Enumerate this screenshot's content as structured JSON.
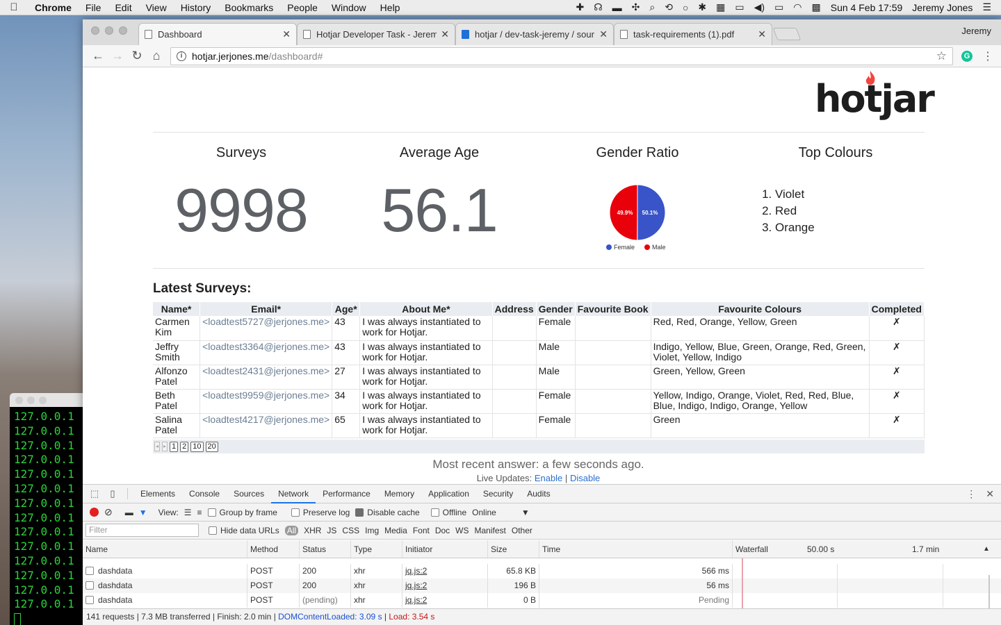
{
  "menubar": {
    "app": "Chrome",
    "items": [
      "File",
      "Edit",
      "View",
      "History",
      "Bookmarks",
      "People",
      "Window",
      "Help"
    ],
    "datetime": "Sun 4 Feb  17:59",
    "user": "Jeremy Jones"
  },
  "terminal": {
    "lines": [
      "127.0.0.1",
      "127.0.0.1",
      "127.0.0.1",
      "127.0.0.1",
      "127.0.0.1",
      "127.0.0.1",
      "127.0.0.1",
      "127.0.0.1",
      "127.0.0.1",
      "127.0.0.1",
      "127.0.0.1",
      "127.0.0.1",
      "127.0.0.1",
      "127.0.0.1"
    ]
  },
  "browser": {
    "tabs": [
      {
        "title": "Dashboard",
        "active": true
      },
      {
        "title": "Hotjar Developer Task - Jerem",
        "active": false
      },
      {
        "title": "hotjar / dev-task-jeremy / sour",
        "active": false
      },
      {
        "title": "task-requirements (1).pdf",
        "active": false
      }
    ],
    "profile": "Jeremy",
    "url_host": "hotjar.jerjones.me",
    "url_path": "/dashboard#"
  },
  "dashboard": {
    "logo": "hotjar",
    "surveys_label": "Surveys",
    "surveys_value": "9998",
    "age_label": "Average Age",
    "age_value": "56.1",
    "gender_label": "Gender Ratio",
    "colours_label": "Top Colours",
    "top_colours": [
      "Violet",
      "Red",
      "Orange"
    ],
    "latest_title": "Latest Surveys:",
    "recent": "Most recent answer: a few seconds ago.",
    "live_label": "Live Updates:",
    "enable": "Enable",
    "disable": "Disable",
    "live_sep": "|",
    "pages": [
      "1",
      "2",
      "10",
      "20"
    ]
  },
  "chart_data": {
    "type": "pie",
    "slices": [
      {
        "label": "Female",
        "value": 49.9,
        "display": "49.9%",
        "color": "#e8000b"
      },
      {
        "label": "Male",
        "value": 50.1,
        "display": "50.1%",
        "color": "#3854c8"
      }
    ],
    "legend": [
      {
        "label": "Female",
        "color": "#3854c8"
      },
      {
        "label": "Male",
        "color": "#e8000b"
      }
    ],
    "legend_placement": "bottom"
  },
  "table": {
    "columns": [
      "Name*",
      "Email*",
      "Age*",
      "About Me*",
      "Address",
      "Gender",
      "Favourite Book",
      "Favourite Colours",
      "Completed"
    ],
    "rows": [
      {
        "name": "Carmen Kim",
        "email": "<loadtest5727@jerjones.me>",
        "age": "43",
        "about": "I was always instantiated to work for Hotjar.",
        "address": "",
        "gender": "Female",
        "book": "",
        "colours": "Red, Red, Orange, Yellow, Green",
        "completed": "✗"
      },
      {
        "name": "Jeffry Smith",
        "email": "<loadtest3364@jerjones.me>",
        "age": "43",
        "about": "I was always instantiated to work for Hotjar.",
        "address": "",
        "gender": "Male",
        "book": "",
        "colours": "Indigo, Yellow, Blue, Green, Orange, Red, Green, Violet, Yellow, Indigo",
        "completed": "✗"
      },
      {
        "name": "Alfonzo Patel",
        "email": "<loadtest2431@jerjones.me>",
        "age": "27",
        "about": "I was always instantiated to work for Hotjar.",
        "address": "",
        "gender": "Male",
        "book": "",
        "colours": "Green, Yellow, Green",
        "completed": "✗"
      },
      {
        "name": "Beth Patel",
        "email": "<loadtest9959@jerjones.me>",
        "age": "34",
        "about": "I was always instantiated to work for Hotjar.",
        "address": "",
        "gender": "Female",
        "book": "",
        "colours": "Yellow, Indigo, Orange, Violet, Red, Red, Blue, Blue, Indigo, Indigo, Orange, Yellow",
        "completed": "✗"
      },
      {
        "name": "Salina Patel",
        "email": "<loadtest4217@jerjones.me>",
        "age": "65",
        "about": "I was always instantiated to work for Hotjar.",
        "address": "",
        "gender": "Female",
        "book": "",
        "colours": "Green",
        "completed": "✗"
      }
    ]
  },
  "devtools": {
    "tabs": [
      "Elements",
      "Console",
      "Sources",
      "Network",
      "Performance",
      "Memory",
      "Application",
      "Security",
      "Audits"
    ],
    "active_tab": "Network",
    "view_label": "View:",
    "group_by_frame": "Group by frame",
    "preserve_log": "Preserve log",
    "disable_cache": "Disable cache",
    "offline": "Offline",
    "online": "Online",
    "filter_placeholder": "Filter",
    "hide_data_urls": "Hide data URLs",
    "filter_types": [
      "All",
      "XHR",
      "JS",
      "CSS",
      "Img",
      "Media",
      "Font",
      "Doc",
      "WS",
      "Manifest",
      "Other"
    ],
    "columns": {
      "name": "Name",
      "method": "Method",
      "status": "Status",
      "type": "Type",
      "initiator": "Initiator",
      "size": "Size",
      "time": "Time",
      "waterfall": "Waterfall",
      "w1": "50.00 s",
      "w2": "1.7 min"
    },
    "requests": [
      {
        "name": "dashdata",
        "method": "POST",
        "status": "200",
        "type": "xhr",
        "initiator": "jq.js:2",
        "size": "65.8 KB",
        "time": "566 ms"
      },
      {
        "name": "dashdata",
        "method": "POST",
        "status": "200",
        "type": "xhr",
        "initiator": "jq.js:2",
        "size": "196 B",
        "time": "56 ms"
      },
      {
        "name": "dashdata",
        "method": "POST",
        "status": "(pending)",
        "type": "xhr",
        "initiator": "jq.js:2",
        "size": "0 B",
        "time": "Pending"
      }
    ],
    "summary": "141 requests | 7.3 MB transferred | Finish: 2.0 min | ",
    "dcl": "DOMContentLoaded: 3.09 s",
    "sep": " | ",
    "load": "Load: 3.54 s"
  }
}
